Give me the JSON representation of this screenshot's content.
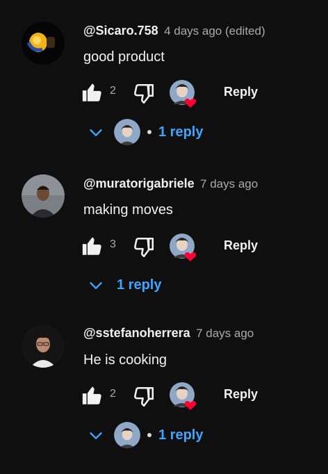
{
  "comments": [
    {
      "author": "@Sicaro.758",
      "time": "4 days ago (edited)",
      "text": "good product",
      "likes": "2",
      "reply_label": "Reply",
      "replies_label": "1 reply",
      "avatar": "lightbulb-avatar",
      "creator_replied": true
    },
    {
      "author": "@muratorigabriele",
      "time": "7 days ago",
      "text": "making moves",
      "likes": "3",
      "reply_label": "Reply",
      "replies_label": "1 reply",
      "avatar": "person-avatar",
      "creator_replied": false
    },
    {
      "author": "@sstefanoherrera",
      "time": "7 days ago",
      "text": "He is cooking",
      "likes": "2",
      "reply_label": "Reply",
      "replies_label": "1 reply",
      "avatar": "person-avatar",
      "creator_replied": true
    }
  ],
  "colors": {
    "background": "#0f0f0f",
    "link": "#3ea6ff",
    "heart": "#ff0033",
    "muted": "#aaaaaa"
  }
}
